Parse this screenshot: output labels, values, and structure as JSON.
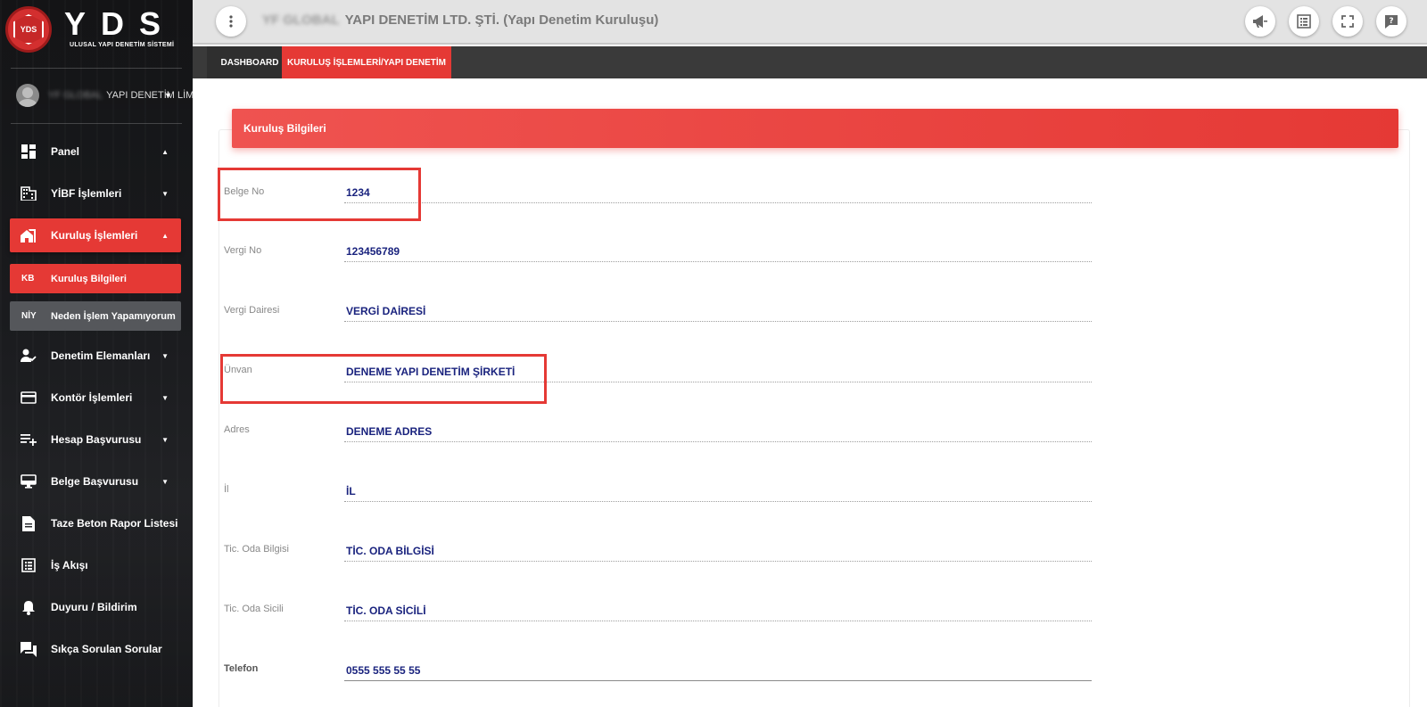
{
  "brand": {
    "logo_text": "YDS",
    "title": "YDS",
    "subtitle": "ULUSAL YAPI DENETİM SİSTEMİ"
  },
  "user": {
    "blurred_prefix": "YF GLOBAL",
    "name": "YAPI DENETİM LİM"
  },
  "sidebar": {
    "items": [
      {
        "label": "Panel",
        "icon": "dashboard-icon",
        "caret": "▲"
      },
      {
        "label": "YİBF İşlemleri",
        "icon": "building-icon",
        "caret": "▼"
      },
      {
        "label": "Kuruluş İşlemleri",
        "icon": "home-work-icon",
        "caret": "▲"
      },
      {
        "label": "Denetim Elemanları",
        "icon": "person-check-icon",
        "caret": "▼"
      },
      {
        "label": "Kontör İşlemleri",
        "icon": "credit-card-icon",
        "caret": "▼"
      },
      {
        "label": "Hesap Başvurusu",
        "icon": "playlist-add-icon",
        "caret": "▼"
      },
      {
        "label": "Belge Başvurusu",
        "icon": "desktop-icon",
        "caret": "▼"
      },
      {
        "label": "Taze Beton Rapor Listesi",
        "icon": "document-icon"
      },
      {
        "label": "İş Akışı",
        "icon": "list-icon"
      },
      {
        "label": "Duyuru / Bildirim",
        "icon": "bell-icon"
      },
      {
        "label": "Sıkça Sorulan Sorular",
        "icon": "forum-icon"
      }
    ],
    "sub_items": [
      {
        "abbr": "KB",
        "label": "Kuruluş Bilgileri"
      },
      {
        "abbr": "NİY",
        "label": "Neden İşlem Yapamıyorum"
      }
    ]
  },
  "topbar": {
    "blurred_prefix": "YF GLOBAL",
    "title": "YAPI DENETİM LTD. ŞTİ. (Yapı Denetim Kuruluşu)",
    "icons": [
      "more-vert-icon",
      "megaphone-icon",
      "list-alt-icon",
      "fullscreen-icon",
      "help-icon"
    ]
  },
  "tabs": [
    {
      "label": "DASHBOARD"
    },
    {
      "label": "KURULUŞ İŞLEMLERİ/YAPI DENETİM"
    }
  ],
  "card": {
    "title": "Kuruluş Bilgileri",
    "fields": [
      {
        "label": "Belge No",
        "value": "1234"
      },
      {
        "label": "Vergi No",
        "value": "123456789"
      },
      {
        "label": "Vergi Dairesi",
        "value": "VERGİ DAİRESİ"
      },
      {
        "label": "Ünvan",
        "value": "DENEME YAPI DENETİM ŞİRKETİ"
      },
      {
        "label": "Adres",
        "value": "DENEME ADRES"
      },
      {
        "label": "İl",
        "value": "İL"
      },
      {
        "label": "Tic. Oda Bilgisi",
        "value": "TİC. ODA BİLGİSİ"
      },
      {
        "label": "Tic. Oda Sicili",
        "value": "TİC. ODA SİCİLİ"
      },
      {
        "label": "Telefon",
        "value": "0555 555 55 55"
      }
    ]
  },
  "colors": {
    "accent": "#e53935",
    "value_text": "#1a237e",
    "tabbar": "#3a3a3a"
  }
}
